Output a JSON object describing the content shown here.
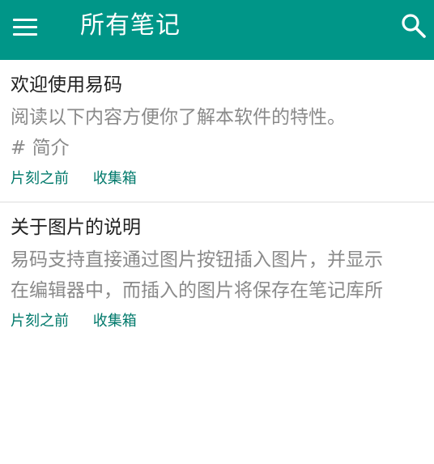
{
  "toolbar": {
    "title": "所有笔记",
    "menu_icon": "hamburger-menu-icon",
    "search_icon": "search-icon",
    "background": "#009688",
    "text_color": "#ffffff"
  },
  "notes": [
    {
      "title": "欢迎使用易码",
      "excerpt_lines": [
        "阅读以下内容方便你了解本软件的特性。",
        "# 简介"
      ],
      "time": "片刻之前",
      "folder": "收集箱"
    },
    {
      "title": "关于图片的说明",
      "excerpt_lines": [
        "易码支持直接通过图片按钮插入图片，并显示",
        "在编辑器中，而插入的图片将保存在笔记库所"
      ],
      "time": "片刻之前",
      "folder": "收集箱"
    }
  ],
  "colors": {
    "accent": "#009688",
    "meta_text": "#00796b",
    "title_text": "#212121",
    "excerpt_text": "#8a8a8a",
    "divider": "#dcdcdc"
  }
}
